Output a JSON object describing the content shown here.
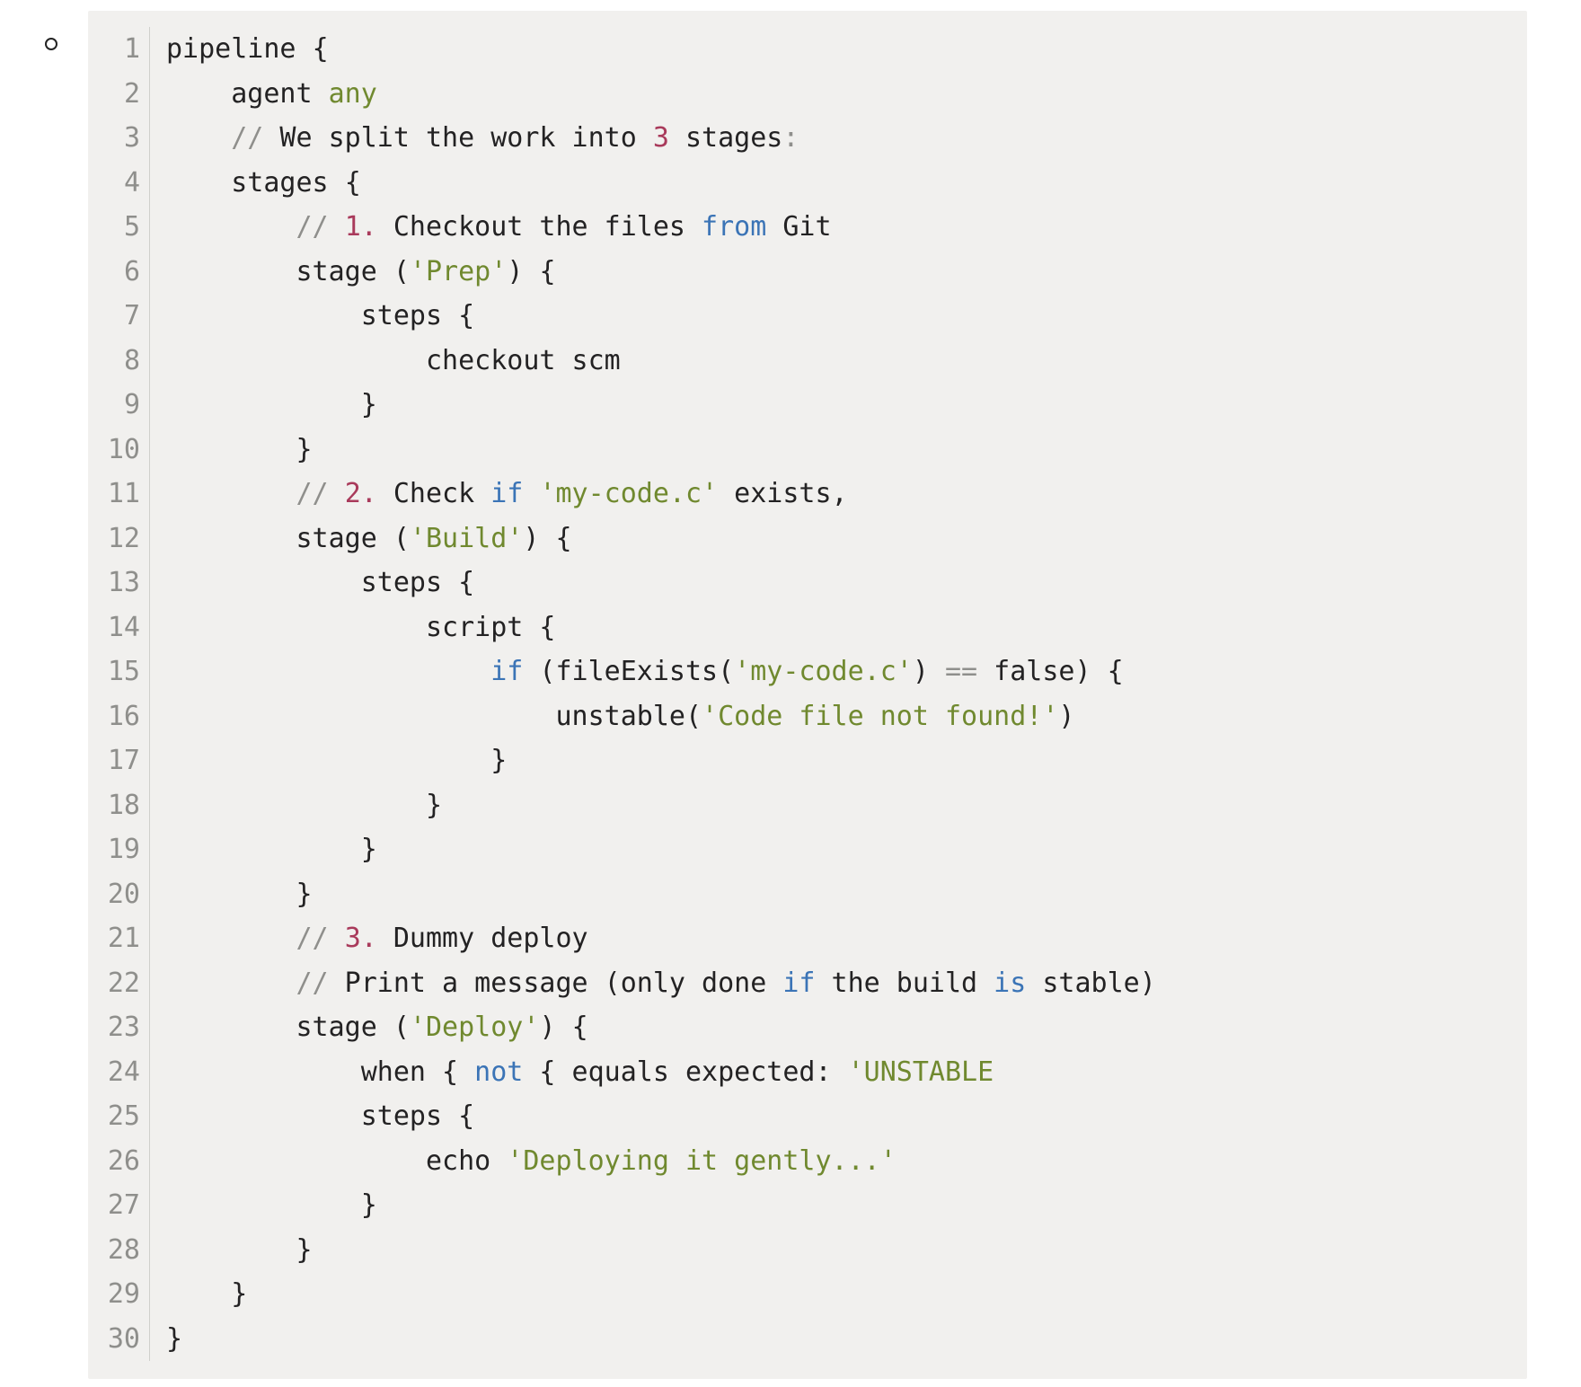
{
  "code": {
    "line_count": 30,
    "lines": {
      "1": [
        [
          "ident",
          "pipeline "
        ],
        [
          "brace",
          "{"
        ]
      ],
      "2": [
        [
          "ident",
          "    agent "
        ],
        [
          "string",
          "any"
        ]
      ],
      "3": [
        [
          "ident",
          "    "
        ],
        [
          "comment",
          "//"
        ],
        [
          "ident",
          " We split the work into "
        ],
        [
          "num",
          "3"
        ],
        [
          "ident",
          " stages"
        ],
        [
          "colon",
          ":"
        ]
      ],
      "4": [
        [
          "ident",
          "    stages "
        ],
        [
          "brace",
          "{"
        ]
      ],
      "5": [
        [
          "ident",
          "        "
        ],
        [
          "comment",
          "//"
        ],
        [
          "ident",
          " "
        ],
        [
          "num",
          "1."
        ],
        [
          "ident",
          " Checkout the files "
        ],
        [
          "kw",
          "from"
        ],
        [
          "ident",
          " Git"
        ]
      ],
      "6": [
        [
          "ident",
          "        stage ("
        ],
        [
          "string",
          "'Prep'"
        ],
        [
          "ident",
          ") "
        ],
        [
          "brace",
          "{"
        ]
      ],
      "7": [
        [
          "ident",
          "            steps "
        ],
        [
          "brace",
          "{"
        ]
      ],
      "8": [
        [
          "ident",
          "                checkout scm"
        ]
      ],
      "9": [
        [
          "ident",
          "            "
        ],
        [
          "brace",
          "}"
        ]
      ],
      "10": [
        [
          "ident",
          "        "
        ],
        [
          "brace",
          "}"
        ]
      ],
      "11": [
        [
          "ident",
          "        "
        ],
        [
          "comment",
          "//"
        ],
        [
          "ident",
          " "
        ],
        [
          "num",
          "2."
        ],
        [
          "ident",
          " Check "
        ],
        [
          "kw",
          "if"
        ],
        [
          "ident",
          " "
        ],
        [
          "string",
          "'my-code.c'"
        ],
        [
          "ident",
          " exists,"
        ]
      ],
      "12": [
        [
          "ident",
          "        stage ("
        ],
        [
          "string",
          "'Build'"
        ],
        [
          "ident",
          ") "
        ],
        [
          "brace",
          "{"
        ]
      ],
      "13": [
        [
          "ident",
          "            steps "
        ],
        [
          "brace",
          "{"
        ]
      ],
      "14": [
        [
          "ident",
          "                script "
        ],
        [
          "brace",
          "{"
        ]
      ],
      "15": [
        [
          "ident",
          "                    "
        ],
        [
          "kw",
          "if"
        ],
        [
          "ident",
          " (fileExists("
        ],
        [
          "string",
          "'my-code.c'"
        ],
        [
          "ident",
          ") "
        ],
        [
          "op",
          "=="
        ],
        [
          "ident",
          " false) "
        ],
        [
          "brace",
          "{"
        ]
      ],
      "16": [
        [
          "ident",
          "                        unstable("
        ],
        [
          "string",
          "'Code file not found!'"
        ],
        [
          "ident",
          ")"
        ]
      ],
      "17": [
        [
          "ident",
          "                    "
        ],
        [
          "brace",
          "}"
        ]
      ],
      "18": [
        [
          "ident",
          "                "
        ],
        [
          "brace",
          "}"
        ]
      ],
      "19": [
        [
          "ident",
          "            "
        ],
        [
          "brace",
          "}"
        ]
      ],
      "20": [
        [
          "ident",
          "        "
        ],
        [
          "brace",
          "}"
        ]
      ],
      "21": [
        [
          "ident",
          "        "
        ],
        [
          "comment",
          "//"
        ],
        [
          "ident",
          " "
        ],
        [
          "num",
          "3."
        ],
        [
          "ident",
          " Dummy deploy"
        ]
      ],
      "22": [
        [
          "ident",
          "        "
        ],
        [
          "comment",
          "//"
        ],
        [
          "ident",
          " Print a message (only done "
        ],
        [
          "kw",
          "if"
        ],
        [
          "ident",
          " the build "
        ],
        [
          "kw",
          "is"
        ],
        [
          "ident",
          " stable)"
        ]
      ],
      "23": [
        [
          "ident",
          "        stage ("
        ],
        [
          "string",
          "'Deploy'"
        ],
        [
          "ident",
          ") "
        ],
        [
          "brace",
          "{"
        ]
      ],
      "24": [
        [
          "ident",
          "            when "
        ],
        [
          "brace",
          "{"
        ],
        [
          "ident",
          " "
        ],
        [
          "kw",
          "not"
        ],
        [
          "ident",
          " "
        ],
        [
          "brace",
          "{"
        ],
        [
          "ident",
          " equals expected: "
        ],
        [
          "string",
          "'UNSTABLE"
        ]
      ],
      "25": [
        [
          "ident",
          "            steps "
        ],
        [
          "brace",
          "{"
        ]
      ],
      "26": [
        [
          "ident",
          "                echo "
        ],
        [
          "string",
          "'Deploying it gently...'"
        ]
      ],
      "27": [
        [
          "ident",
          "            "
        ],
        [
          "brace",
          "}"
        ]
      ],
      "28": [
        [
          "ident",
          "        "
        ],
        [
          "brace",
          "}"
        ]
      ],
      "29": [
        [
          "ident",
          "    "
        ],
        [
          "brace",
          "}"
        ]
      ],
      "30": [
        [
          "brace",
          "}"
        ]
      ]
    }
  }
}
